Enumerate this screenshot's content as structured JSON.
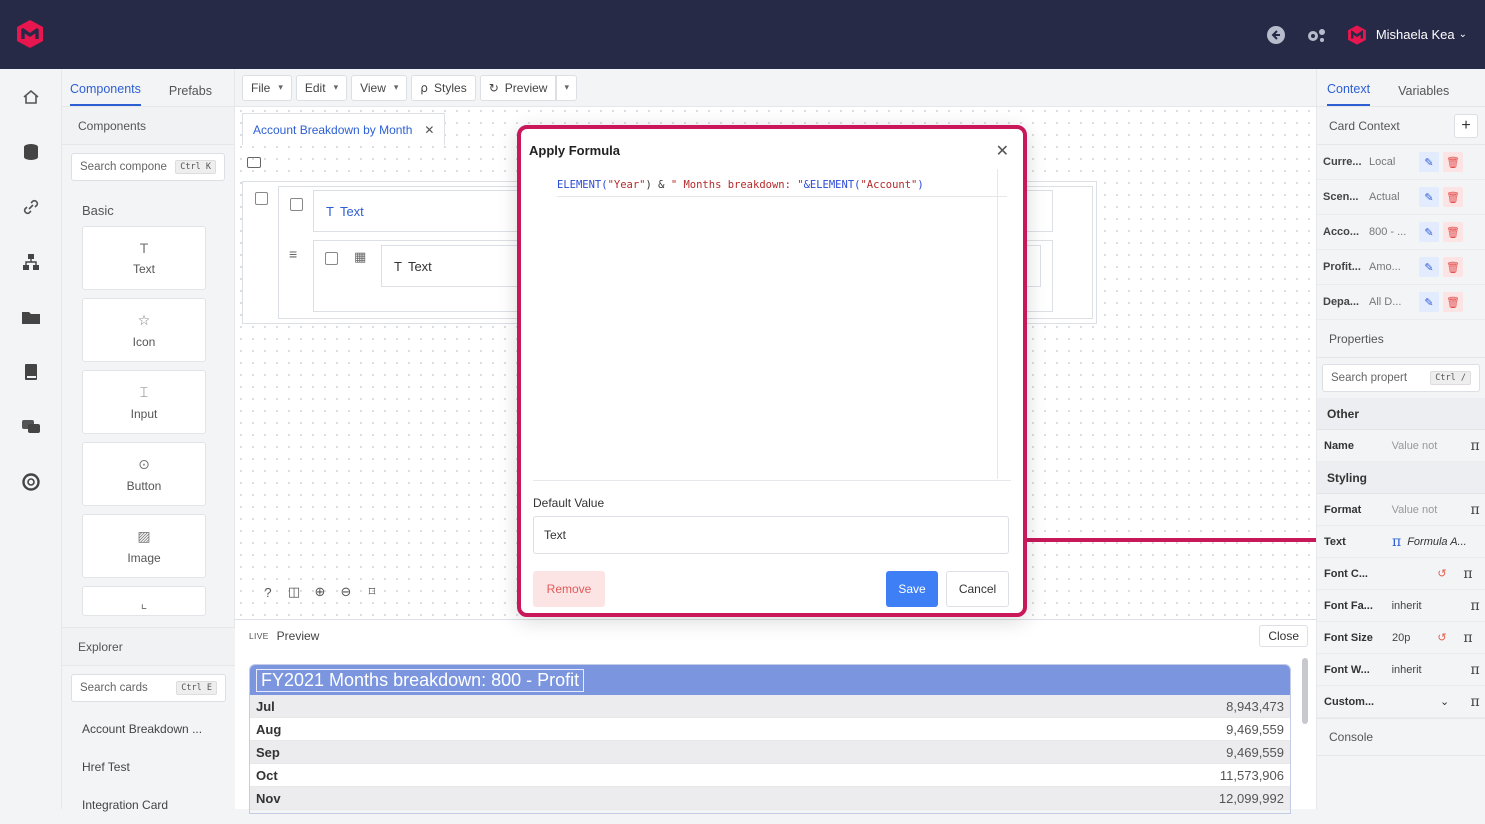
{
  "colors": {
    "brand": "#e8164f",
    "accent": "#2d5fd3",
    "highlight": "#c8185a",
    "topbar": "#262a47"
  },
  "header": {
    "user_name": "Mishaela Kea",
    "icons": [
      "back-arrow-icon",
      "settings-gears-icon",
      "brand-logo-icon"
    ]
  },
  "left_panel": {
    "tabs": [
      "Components",
      "Prefabs"
    ],
    "section_title": "Components",
    "search_placeholder": "Search compone",
    "search_shortcut": "Ctrl K",
    "group_title": "Basic",
    "components": [
      {
        "label": "Text",
        "icon": "T"
      },
      {
        "label": "Icon",
        "icon": "☆"
      },
      {
        "label": "Input",
        "icon": "⌶"
      },
      {
        "label": "Button",
        "icon": "⊙"
      },
      {
        "label": "Image",
        "icon": "▨"
      }
    ],
    "explorer": {
      "title": "Explorer",
      "search_placeholder": "Search cards",
      "search_shortcut": "Ctrl E",
      "items": [
        "Account Breakdown ...",
        "Href Test",
        "Integration Card"
      ]
    }
  },
  "toolbar": {
    "file": "File",
    "edit": "Edit",
    "view": "View",
    "styles": "Styles",
    "preview": "Preview"
  },
  "canvas": {
    "card_tab": "Account Breakdown by Month",
    "text_el_1": "Text",
    "text_el_2": "Text"
  },
  "modal": {
    "title": "Apply Formula",
    "formula_parts": [
      {
        "t": "ELEMENT(",
        "c": "fn"
      },
      {
        "t": "\"Year\"",
        "c": "st"
      },
      {
        "t": ") & ",
        "c": "fn"
      },
      {
        "t": "\" Months breakdown: \"",
        "c": "st"
      },
      {
        "t": "&ELEMENT(",
        "c": "fn"
      },
      {
        "t": "\"Account\"",
        "c": "st"
      },
      {
        "t": ")",
        "c": "fn"
      }
    ],
    "default_value_label": "Default Value",
    "default_value": "Text",
    "remove": "Remove",
    "save": "Save",
    "cancel": "Cancel"
  },
  "preview": {
    "live": "LIVE",
    "label": "Preview",
    "close": "Close",
    "title": "FY2021 Months breakdown: 800 - Profit",
    "rows": [
      {
        "month": "Jul",
        "value": "8,943,473"
      },
      {
        "month": "Aug",
        "value": "9,469,559"
      },
      {
        "month": "Sep",
        "value": "9,469,559"
      },
      {
        "month": "Oct",
        "value": "11,573,906"
      },
      {
        "month": "Nov",
        "value": "12,099,992"
      }
    ]
  },
  "right_panel": {
    "tabs": [
      "Context",
      "Variables"
    ],
    "card_context": "Card Context",
    "context_rows": [
      {
        "key": "Curre...",
        "value": "Local"
      },
      {
        "key": "Scen...",
        "value": "Actual"
      },
      {
        "key": "Acco...",
        "value": "800 - ..."
      },
      {
        "key": "Profit...",
        "value": "Amo..."
      },
      {
        "key": "Depa...",
        "value": "All D..."
      }
    ],
    "properties_title": "Properties",
    "search_placeholder": "Search propert",
    "search_shortcut": "Ctrl /",
    "other_group": "Other",
    "name_key": "Name",
    "name_value": "Value not",
    "styling_group": "Styling",
    "props": [
      {
        "key": "Format",
        "value": "Value not",
        "reset": false
      },
      {
        "key": "Text",
        "value": "Formula A...",
        "reset": false,
        "formula": true
      },
      {
        "key": "Font C...",
        "value": "",
        "reset": true
      },
      {
        "key": "Font Fa...",
        "value": "inherit",
        "reset": false
      },
      {
        "key": "Font Size",
        "value": "20p",
        "reset": true
      },
      {
        "key": "Font W...",
        "value": "inherit",
        "reset": false
      },
      {
        "key": "Custom...",
        "value": "",
        "reset": false,
        "select": true
      }
    ],
    "console": "Console"
  }
}
